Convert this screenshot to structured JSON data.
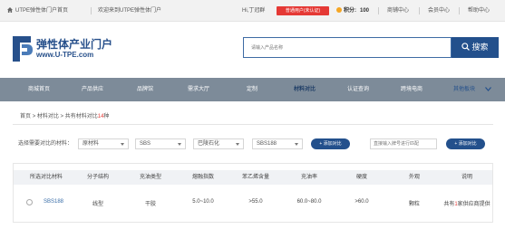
{
  "topbar": {
    "home_link": "UTPE弹性体门户首页",
    "welcome": "欢迎来到UTPE弹性体门户",
    "greeting": "Hi,丁冠群",
    "badge": "普通用户(未认证)",
    "points_label": "积分:",
    "points_value": "100",
    "links": [
      "商铺中心",
      "会员中心",
      "帮助中心"
    ]
  },
  "header": {
    "logo_title": "弹性体产业门户",
    "logo_url": "www.U-TPE.com",
    "search_placeholder": "请输入产品名称",
    "search_button": "搜索"
  },
  "nav": {
    "items": [
      "商城首页",
      "产品供应",
      "品牌馆",
      "需求大厅",
      "定制",
      "材料对比",
      "认证查询",
      "跨境电商"
    ],
    "active_index": 5,
    "more_label": "其他板块"
  },
  "breadcrumb": {
    "home": "首页",
    "level1": "材料对比",
    "level2_prefix": "共有材料对比",
    "count": "14",
    "level2_suffix": "种"
  },
  "filter": {
    "label": "选择需要对比的材料：",
    "selects": [
      "原材料",
      "SBS",
      "巴陵石化",
      "SBS188"
    ],
    "add_button": "+ 添加对比",
    "brand_placeholder": "直接输入牌号进行匹配",
    "add_button_2": "+ 添加对比"
  },
  "table": {
    "headers": [
      "所选对比材料",
      "分子结构",
      "充油类型",
      "熔融指数",
      "苯乙烯含量",
      "充油率",
      "硬度",
      "外观",
      "说明"
    ],
    "rows": [
      {
        "material": "SBS188",
        "structure": "线型",
        "oil_type": "干胶",
        "melt_index": "5.0~10.0",
        "styrene": ">55.0",
        "oil_rate": "60.0~80.0",
        "hardness": ">60.0",
        "appearance": "颗粒",
        "note_prefix": "共有",
        "note_count": "1",
        "note_suffix": "家供应商提供"
      }
    ]
  },
  "colors": {
    "brand_blue": "#23508c",
    "nav_gray": "#7d8b99",
    "accent_red": "#e53935"
  }
}
